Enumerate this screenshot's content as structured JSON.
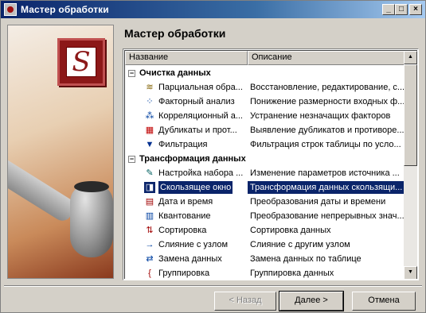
{
  "window": {
    "title": "Мастер обработки"
  },
  "titlebar_buttons": {
    "minimize": "_",
    "maximize": "□",
    "close": "×"
  },
  "wizard": {
    "heading": "Мастер обработки",
    "logo_letter": "S"
  },
  "list": {
    "columns": [
      "Название",
      "Описание"
    ],
    "groups": [
      {
        "expander": "−",
        "label": "Очистка данных",
        "items": [
          {
            "icon": "partial-processing-icon",
            "glyph": "≋",
            "name": "Парциальная обра...",
            "desc": "Восстановление, редактирование, с...",
            "color": "#806000"
          },
          {
            "icon": "factor-analysis-icon",
            "glyph": "⁘",
            "name": "Факторный анализ",
            "desc": "Понижение размерности входных ф...",
            "color": "#0040a0"
          },
          {
            "icon": "correlation-icon",
            "glyph": "⁂",
            "name": "Корреляционный а...",
            "desc": "Устранение незначащих факторов",
            "color": "#0040a0"
          },
          {
            "icon": "duplicates-icon",
            "glyph": "▦",
            "name": "Дубликаты и прот...",
            "desc": "Выявление дубликатов и противоре...",
            "color": "#c00000"
          },
          {
            "icon": "filter-icon",
            "glyph": "▼",
            "name": "Фильтрация",
            "desc": "Фильтрация строк таблицы по усло...",
            "color": "#003090"
          }
        ]
      },
      {
        "expander": "−",
        "label": "Трансформация данных",
        "items": [
          {
            "icon": "dataset-settings-icon",
            "glyph": "✎",
            "name": "Настройка набора ...",
            "desc": "Изменение параметров источника ...",
            "color": "#006060"
          },
          {
            "icon": "sliding-window-icon",
            "glyph": "◨",
            "name": "Скользящее окно",
            "desc": "Трансформация данных скользящи...",
            "color": "#ffffff",
            "selected": true
          },
          {
            "icon": "date-time-icon",
            "glyph": "▤",
            "name": "Дата и время",
            "desc": "Преобразования даты и времени",
            "color": "#a00000"
          },
          {
            "icon": "quantization-icon",
            "glyph": "▥",
            "name": "Квантование",
            "desc": "Преобразование непрерывных знач...",
            "color": "#0040a0"
          },
          {
            "icon": "sorting-icon",
            "glyph": "⇅",
            "name": "Сортировка",
            "desc": "Сортировка данных",
            "color": "#a00000"
          },
          {
            "icon": "merge-icon",
            "glyph": "→",
            "name": "Слияние с узлом",
            "desc": "Слияние с другим узлом",
            "color": "#0040a0"
          },
          {
            "icon": "replace-data-icon",
            "glyph": "⇄",
            "name": "Замена данных",
            "desc": "Замена данных по таблице",
            "color": "#0040a0"
          },
          {
            "icon": "grouping-icon",
            "glyph": "{",
            "name": "Группировка",
            "desc": "Группировка данных",
            "color": "#a00000"
          }
        ]
      }
    ]
  },
  "scrollbar": {
    "up": "▲",
    "down": "▼"
  },
  "buttons": {
    "back": "< Назад",
    "next": "Далее >",
    "cancel": "Отмена"
  }
}
